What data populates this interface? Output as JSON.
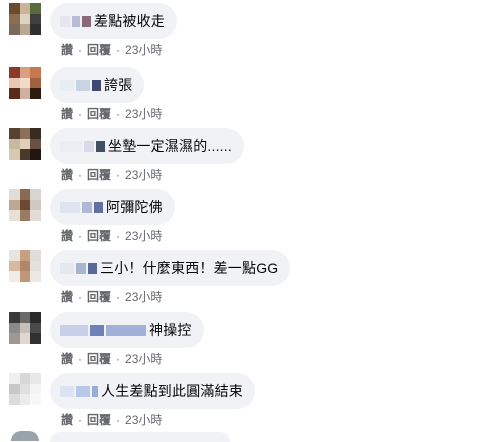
{
  "comments": [
    {
      "text": "差點被收走",
      "like_label": "讚",
      "reply_label": "回覆",
      "time": "23小時",
      "avatar_colors": [
        "#6b4a2e",
        "#c9b49a",
        "#5a6a3a",
        "#8c6d4f",
        "#e0d2c0",
        "#3f3f3f",
        "#7a6a5a",
        "#b8a890",
        "#2f2f2f"
      ],
      "name_blur_colors": [
        "#e6e6f0",
        "#b8bcd8",
        "#8a6a7a"
      ]
    },
    {
      "text": "誇張",
      "like_label": "讚",
      "reply_label": "回覆",
      "time": "23小時",
      "avatar_colors": [
        "#8a3a2a",
        "#d8a080",
        "#c87850",
        "#e8c8b0",
        "#f0dcc8",
        "#a06040",
        "#5a2a1a",
        "#d0b0a0",
        "#2a1a10"
      ],
      "name_blur_colors": [
        "#e6eef4",
        "#c8d4e0",
        "#404870"
      ]
    },
    {
      "text": "坐墊一定濕濕的......",
      "like_label": "讚",
      "reply_label": "回覆",
      "time": "23小時",
      "avatar_colors": [
        "#5a4030",
        "#8a7058",
        "#3a2a20",
        "#c8b8a0",
        "#e0d0b8",
        "#6a5040",
        "#d8c8b0",
        "#4a3a2a",
        "#201810"
      ],
      "name_blur_colors": [
        "#ececf4",
        "#d8dae8",
        "#405060"
      ]
    },
    {
      "text": "阿彌陀佛",
      "like_label": "讚",
      "reply_label": "回覆",
      "time": "23小時",
      "avatar_colors": [
        "#e0dcd8",
        "#8a6a50",
        "#d8d4d0",
        "#c0a890",
        "#6a4a30",
        "#d0c8c0",
        "#e8e0d8",
        "#9a7a60",
        "#e4dcd4"
      ],
      "name_blur_colors": [
        "#e0e4f0",
        "#b0b8d8",
        "#6070a0"
      ]
    },
    {
      "text": "三小！什麼東西！差一點GG",
      "like_label": "讚",
      "reply_label": "回覆",
      "time": "23小時",
      "avatar_colors": [
        "#e8e4e0",
        "#c8a080",
        "#e0dcd8",
        "#d8b8a0",
        "#b08868",
        "#e4e0dc",
        "#f0ece8",
        "#c09878",
        "#ece8e4"
      ],
      "name_blur_colors": [
        "#e4e8f0",
        "#a8b4d0",
        "#5a6a98"
      ]
    },
    {
      "text": "神操控",
      "like_label": "讚",
      "reply_label": "回覆",
      "time": "23小時",
      "avatar_colors": [
        "#3a3a3a",
        "#6a6a6a",
        "#2a2a2a",
        "#8a8a8a",
        "#c8c0b8",
        "#4a4a4a",
        "#a09890",
        "#e0d8d0",
        "#303030"
      ],
      "name_blur_colors": [
        "#c8d0e8",
        "#7080b8",
        "#a0b0d8"
      ]
    },
    {
      "text": "人生差點到此圓滿結束",
      "like_label": "讚",
      "reply_label": "回覆",
      "time": "23小時",
      "avatar_colors": [
        "#f0f0f0",
        "#d8d8d8",
        "#e8e8e8",
        "#c8c8c8",
        "#e0e0e0",
        "#f4f4f4",
        "#dcdcdc",
        "#ececec",
        "#f8f8f8"
      ],
      "name_blur_colors": [
        "#dce4f4",
        "#b8c8e8",
        "#98acd8"
      ]
    }
  ]
}
